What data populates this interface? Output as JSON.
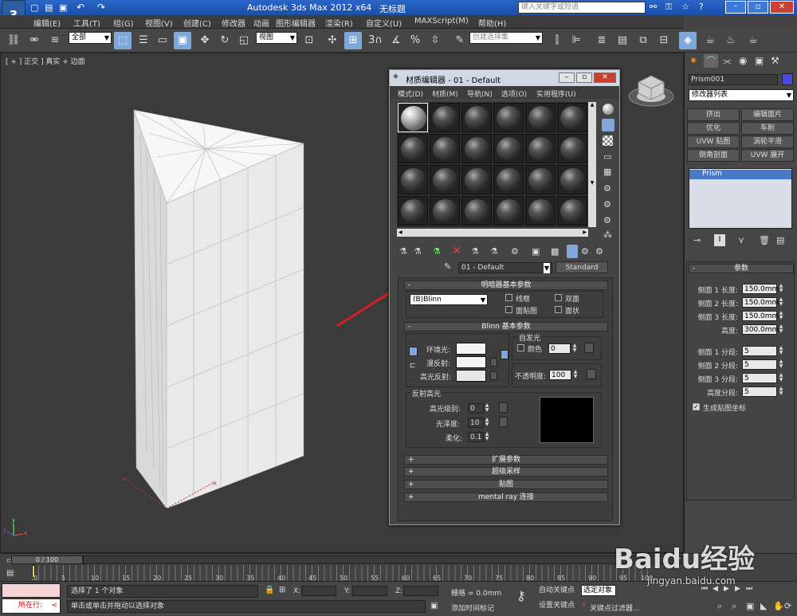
{
  "app": {
    "title": "Autodesk 3ds Max  2012 x64",
    "file_title": "无标题",
    "search_placeholder": "键入关键字或短语"
  },
  "menu": [
    "编辑(E)",
    "工具(T)",
    "组(G)",
    "视图(V)",
    "创建(C)",
    "修改器",
    "动画",
    "图形编辑器",
    "渲染(R)",
    "自定义(U)",
    "MAXScript(M)",
    "帮助(H)"
  ],
  "toolbar": {
    "selection_filter": "全部",
    "ref_coord": "视图",
    "named_selection": "创建选择集"
  },
  "viewport": {
    "label": "[ + ] 正交 ] 真实 + 边面"
  },
  "material_editor": {
    "title": "材质编辑器 - 01 - Default",
    "menu": [
      "模式(D)",
      "材质(M)",
      "导航(N)",
      "选项(O)",
      "实用程序(U)"
    ],
    "material_name": "01 - Default",
    "material_type": "Standard",
    "shader_rollout": "明暗器基本参数",
    "shader": "(B)Blinn",
    "wire": "线框",
    "two_sided": "双面",
    "face_map": "面贴图",
    "faceted": "面状",
    "blinn_rollout": "Blinn 基本参数",
    "self_illum": "自发光",
    "color_label": "颜色",
    "self_illum_value": "0",
    "ambient": "环境光:",
    "diffuse": "漫反射:",
    "specular": "高光反射:",
    "opacity_label": "不透明度:",
    "opacity_value": "100",
    "spec_highlights": "反射高光",
    "spec_level_label": "高光级别:",
    "spec_level": "0",
    "gloss_label": "光泽度:",
    "gloss": "10",
    "soften_label": "柔化:",
    "soften": "0.1",
    "rollouts": [
      "扩展参数",
      "超级采样",
      "贴图",
      "mental ray 连接"
    ]
  },
  "command_panel": {
    "object_name": "Prism001",
    "object_color": "#4a4ae0",
    "modifier_list": "修改器列表",
    "buttons": [
      "挤出",
      "编辑面片",
      "优化",
      "车削",
      "UVW 贴图",
      "涡轮平滑",
      "倒角剖面",
      "UVW 展开"
    ],
    "stack_item": "Prism",
    "params_title": "参数",
    "params": [
      {
        "label": "侧面 1 长度:",
        "value": "150.0mm"
      },
      {
        "label": "侧面 2 长度:",
        "value": "150.0mm"
      },
      {
        "label": "侧面 3 长度:",
        "value": "150.0mm"
      },
      {
        "label": "高度:",
        "value": "300.0mm"
      },
      {
        "label": "侧面 1 分段:",
        "value": "5"
      },
      {
        "label": "侧面 2 分段:",
        "value": "5"
      },
      {
        "label": "侧面 3 分段:",
        "value": "5"
      },
      {
        "label": "高度分段:",
        "value": "5"
      }
    ],
    "gen_map": "生成贴图坐标"
  },
  "timeline": {
    "frame": "0 / 100",
    "ticks": [
      "0",
      "5",
      "10",
      "15",
      "20",
      "25",
      "30",
      "35",
      "40",
      "45",
      "50",
      "55",
      "60",
      "65",
      "70",
      "75",
      "80",
      "85",
      "90",
      "95",
      "100"
    ]
  },
  "status": {
    "script": "所在行:",
    "selected": "选择了 1 个对象",
    "prompt": "单击或单击并拖动以选择对象",
    "x_label": "X:",
    "y_label": "Y:",
    "z_label": "Z:",
    "grid": "栅格 = 0.0mm",
    "add_time_tag": "添加时间标记",
    "auto_key": "自动关键点",
    "selected_obj": "选定对象",
    "set_key": "设置关键点",
    "key_filter": "关键点过滤器..."
  },
  "watermark": "Baidu经验",
  "watermark_url": "jingyan.baidu.com"
}
